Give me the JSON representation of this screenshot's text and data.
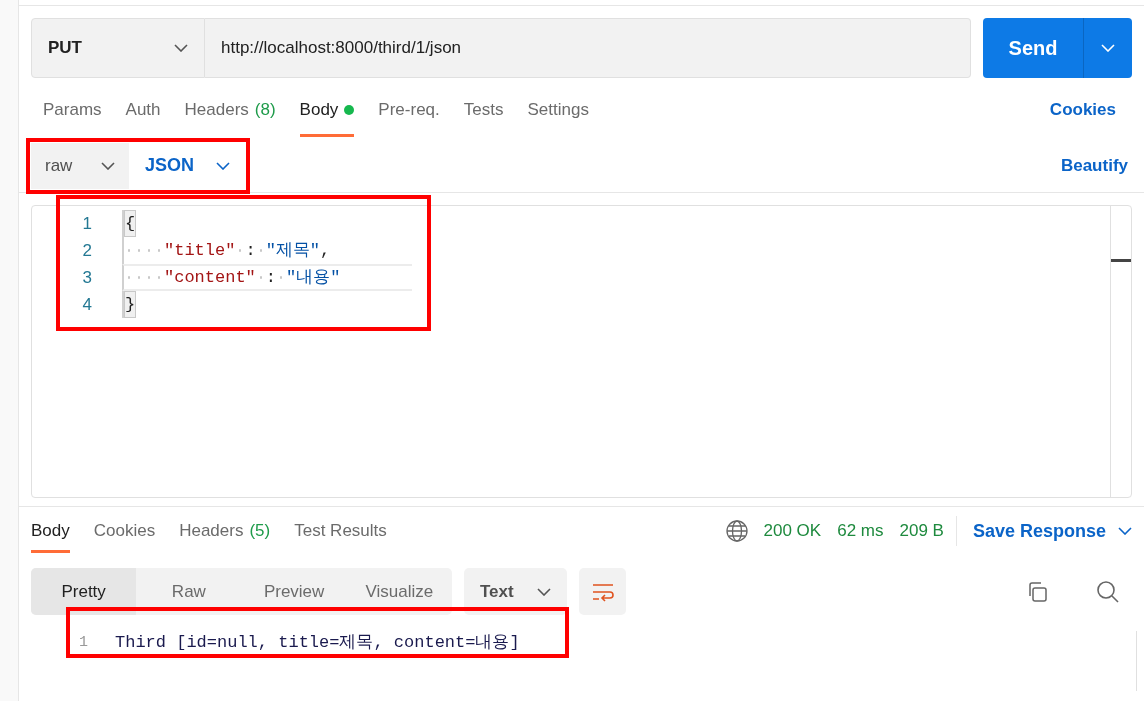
{
  "request": {
    "method": "PUT",
    "url": "http://localhost:8000/third/1/json",
    "send": "Send"
  },
  "request_tabs": [
    {
      "label": "Params",
      "selected": false
    },
    {
      "label": "Auth",
      "selected": false
    },
    {
      "label": "Headers",
      "count": "(8)",
      "selected": false
    },
    {
      "label": "Body",
      "dot": true,
      "selected": true
    },
    {
      "label": "Pre-req.",
      "selected": false
    },
    {
      "label": "Tests",
      "selected": false
    },
    {
      "label": "Settings",
      "selected": false
    }
  ],
  "cookies_link": "Cookies",
  "body_options": {
    "mode": "raw",
    "language": "JSON",
    "highlighted": true,
    "beautify": "Beautify"
  },
  "editor": {
    "highlighted": true,
    "lines": [
      {
        "number": "1",
        "active": false,
        "indented": false,
        "tokens": [
          {
            "kind": "bracket",
            "text": "{"
          }
        ]
      },
      {
        "number": "2",
        "active": false,
        "indented": true,
        "tokens": [
          {
            "kind": "key",
            "text": "\"title\""
          },
          {
            "kind": "space"
          },
          {
            "kind": "punct",
            "text": ":"
          },
          {
            "kind": "space"
          },
          {
            "kind": "string",
            "text": "\"제목\""
          },
          {
            "kind": "punct",
            "text": ","
          }
        ]
      },
      {
        "number": "3",
        "active": true,
        "indented": true,
        "tokens": [
          {
            "kind": "key",
            "text": "\"content\""
          },
          {
            "kind": "space"
          },
          {
            "kind": "punct",
            "text": ":"
          },
          {
            "kind": "space"
          },
          {
            "kind": "string",
            "text": "\"내용\""
          }
        ]
      },
      {
        "number": "4",
        "active": false,
        "indented": false,
        "tokens": [
          {
            "kind": "bracket",
            "text": "}"
          }
        ]
      }
    ]
  },
  "response_tabs": [
    {
      "label": "Body",
      "selected": true
    },
    {
      "label": "Cookies",
      "selected": false
    },
    {
      "label": "Headers",
      "count": "(5)",
      "selected": false
    },
    {
      "label": "Test Results",
      "selected": false
    }
  ],
  "status": {
    "code": "200 OK",
    "time": "62 ms",
    "size": "209 B",
    "save": "Save Response"
  },
  "view_modes": [
    {
      "label": "Pretty",
      "selected": true
    },
    {
      "label": "Raw",
      "selected": false
    },
    {
      "label": "Preview",
      "selected": false
    },
    {
      "label": "Visualize",
      "selected": false
    }
  ],
  "format": "Text",
  "output": {
    "highlighted": true,
    "lines": [
      {
        "number": "1",
        "text": "Third [id=null, title=제목, content=내용]"
      }
    ]
  }
}
